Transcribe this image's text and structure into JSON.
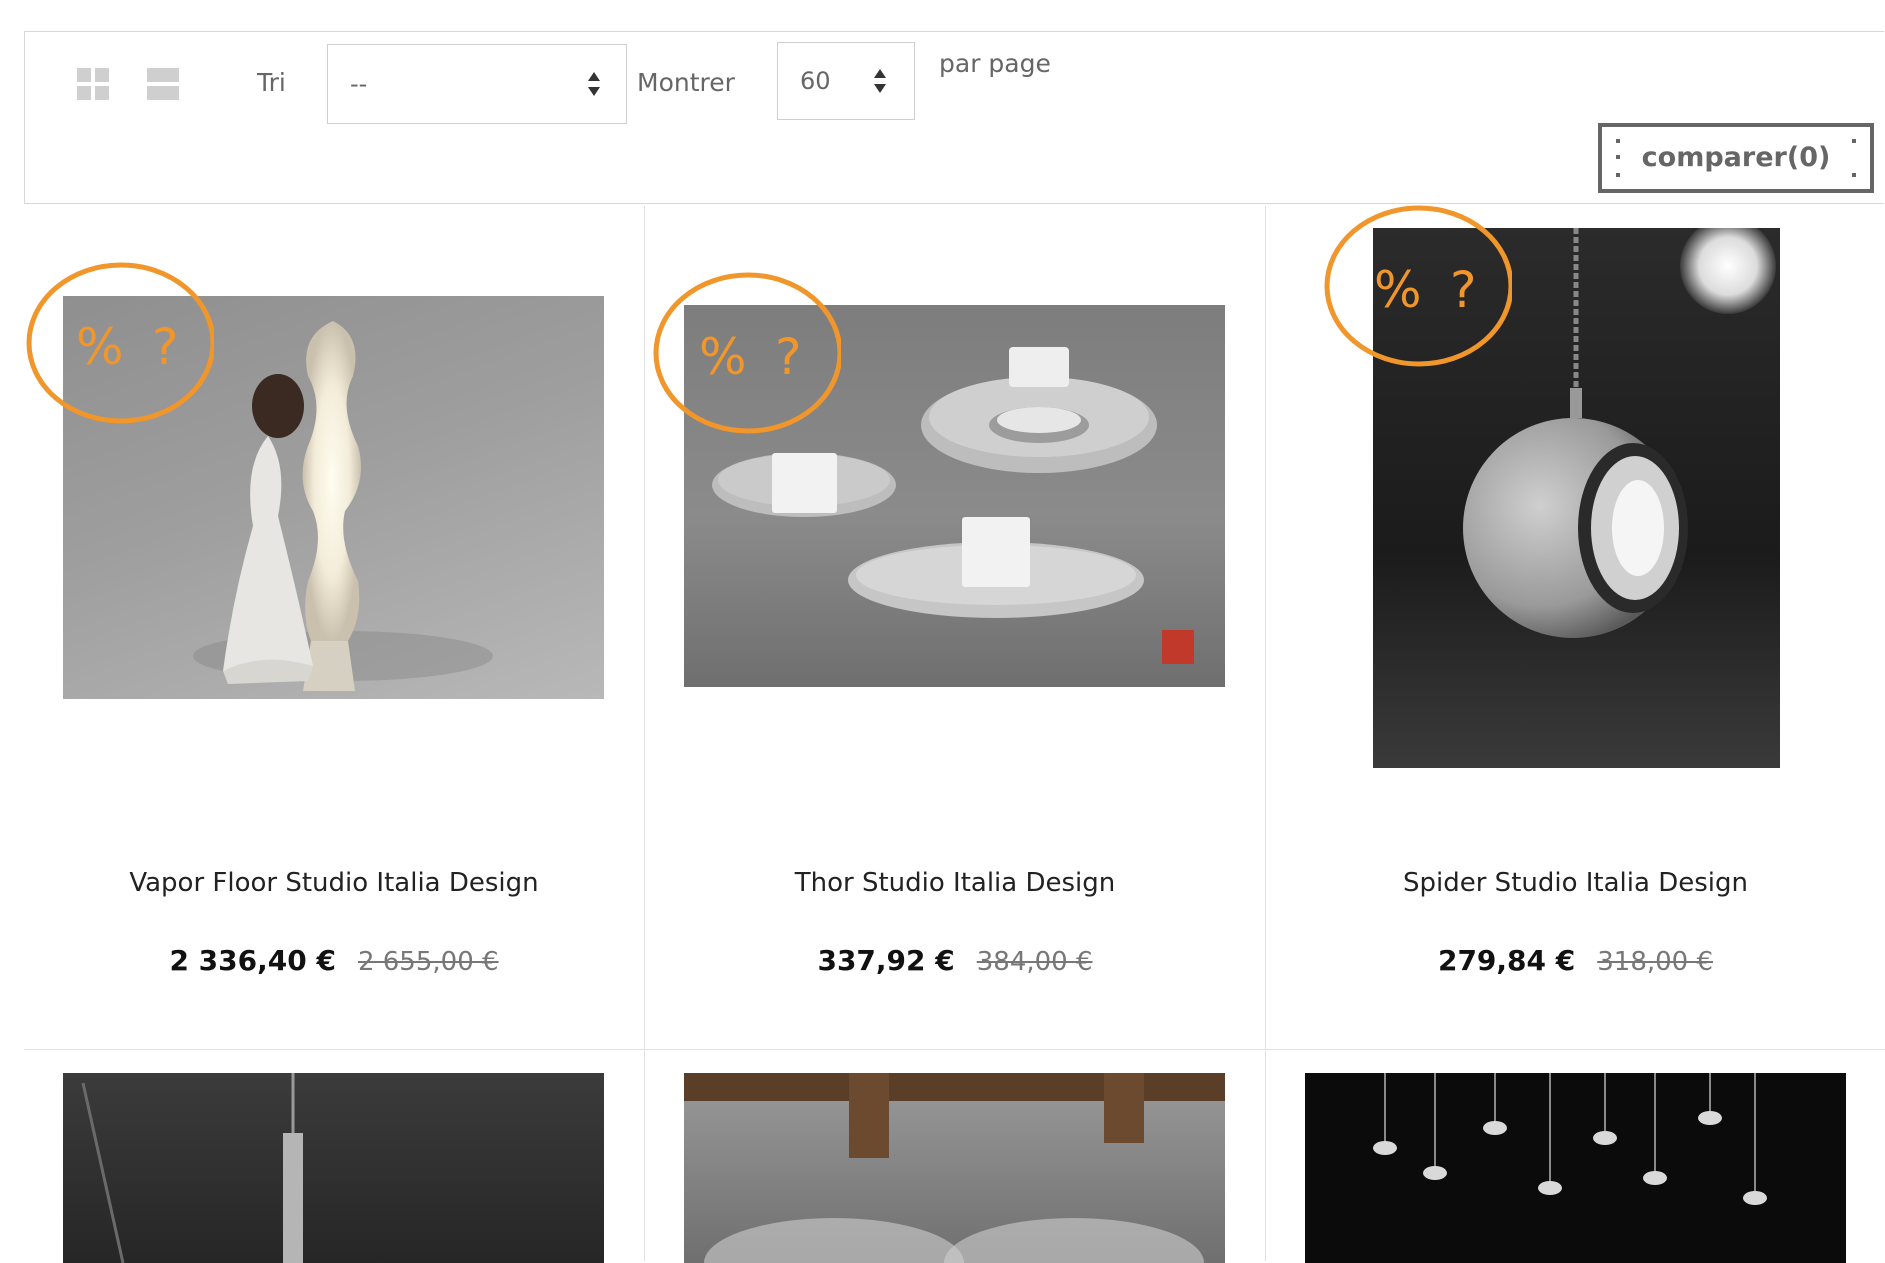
{
  "toolbar": {
    "sort_label": "Tri",
    "sort_value": "--",
    "show_label": "Montrer",
    "per_page_value": "60",
    "per_page_suffix": "par page",
    "compare_label": "comparer(0)"
  },
  "badge_text": "% ?",
  "accent_color": "#f0962a",
  "products": [
    {
      "name": "Vapor Floor Studio Italia Design",
      "price": "2 336,40 €",
      "old_price": "2 655,00 €"
    },
    {
      "name": "Thor Studio Italia Design",
      "price": "337,92 €",
      "old_price": "384,00 €"
    },
    {
      "name": "Spider Studio Italia Design",
      "price": "279,84 €",
      "old_price": "318,00 €"
    }
  ]
}
